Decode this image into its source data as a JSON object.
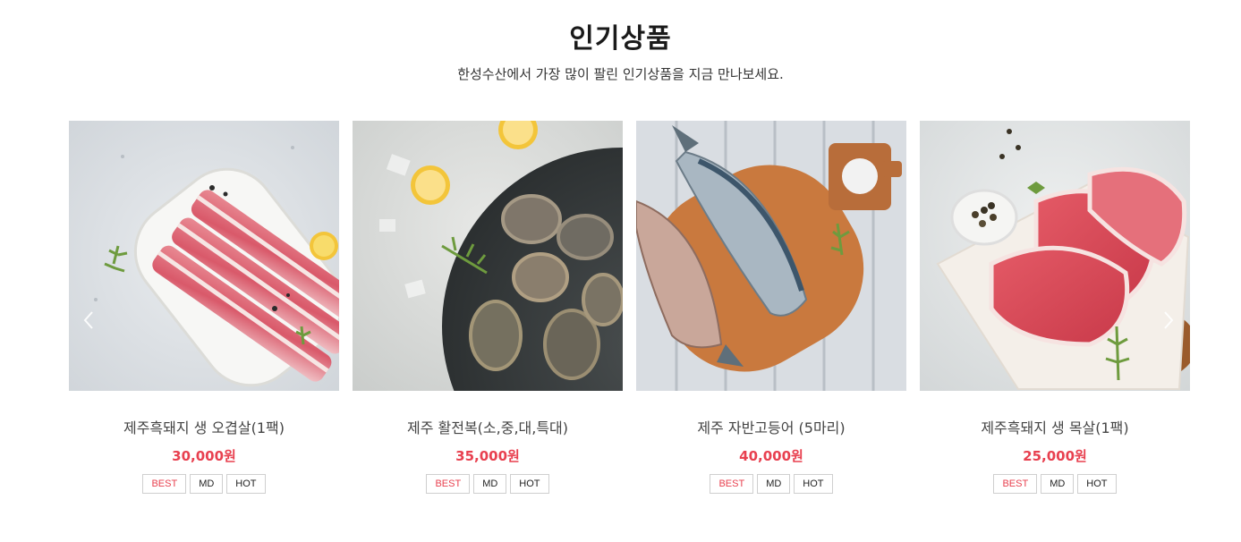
{
  "section": {
    "title": "인기상품",
    "subtitle": "한성수산에서 가장 많이 팔린 인기상품을 지금 만나보세요."
  },
  "products": [
    {
      "name": "제주흑돼지 생 오겹살(1팩)",
      "price": "30,000원",
      "tags": [
        "BEST",
        "MD",
        "HOT"
      ],
      "image": "pork-belly-image"
    },
    {
      "name": "제주 활전복(소,중,대,특대)",
      "price": "35,000원",
      "tags": [
        "BEST",
        "MD",
        "HOT"
      ],
      "image": "abalone-image"
    },
    {
      "name": "제주 자반고등어 (5마리)",
      "price": "40,000원",
      "tags": [
        "BEST",
        "MD",
        "HOT"
      ],
      "image": "mackerel-image"
    },
    {
      "name": "제주흑돼지 생 목살(1팩)",
      "price": "25,000원",
      "tags": [
        "BEST",
        "MD",
        "HOT"
      ],
      "image": "pork-neck-image"
    }
  ],
  "colors": {
    "price": "#e8404f",
    "best_tag": "#e8404f",
    "tag_border": "#cfcfcf"
  },
  "icons": {
    "prev": "chevron-left-icon",
    "next": "chevron-right-icon"
  }
}
